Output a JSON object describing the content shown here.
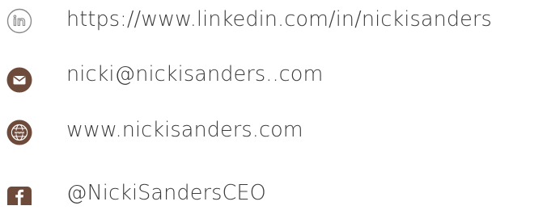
{
  "contacts": {
    "linkedin": {
      "icon": "linkedin-icon",
      "text": "https://www.linkedin.com/in/nickisanders"
    },
    "email": {
      "icon": "email-icon",
      "text": "nicki@nickisanders..com"
    },
    "website": {
      "icon": "globe-icon",
      "text": "www.nickisanders.com"
    },
    "facebook": {
      "icon": "facebook-icon",
      "text": "@NickiSandersCEO"
    }
  },
  "colors": {
    "text": "#3c3c3c",
    "icon_fill": "#6e4a3a",
    "icon_outline": "#8a8a8a"
  }
}
